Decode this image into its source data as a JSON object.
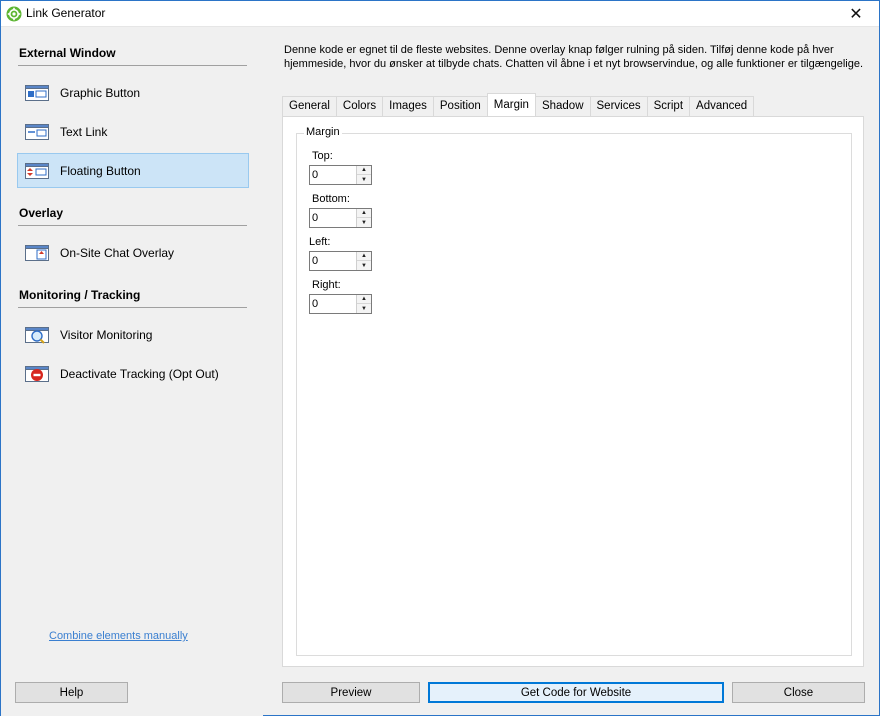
{
  "window": {
    "title": "Link Generator",
    "app_icon": "gear-icon",
    "close_glyph": "✕"
  },
  "sidebar": {
    "sections": [
      {
        "heading": "External Window",
        "items": [
          {
            "label": "Graphic Button",
            "icon": "graphic-button-icon",
            "selected": false
          },
          {
            "label": "Text Link",
            "icon": "text-link-icon",
            "selected": false
          },
          {
            "label": "Floating Button",
            "icon": "floating-button-icon",
            "selected": true
          }
        ]
      },
      {
        "heading": "Overlay",
        "items": [
          {
            "label": "On-Site Chat Overlay",
            "icon": "chat-overlay-icon",
            "selected": false
          }
        ]
      },
      {
        "heading": "Monitoring / Tracking",
        "items": [
          {
            "label": "Visitor Monitoring",
            "icon": "visitor-monitoring-icon",
            "selected": false
          },
          {
            "label": "Deactivate Tracking (Opt Out)",
            "icon": "deactivate-tracking-icon",
            "selected": false
          }
        ]
      }
    ],
    "combine_link": "Combine elements manually"
  },
  "main": {
    "description": "Denne kode er egnet til de fleste websites. Denne overlay knap følger rulning på siden. Tilføj denne kode på hver hjemmeside, hvor du ønsker at tilbyde chats. Chatten vil åbne i et nyt browservindue, og alle funktioner er tilgængelige.",
    "tabs": [
      "General",
      "Colors",
      "Images",
      "Position",
      "Margin",
      "Shadow",
      "Services",
      "Script",
      "Advanced"
    ],
    "active_tab": "Margin",
    "group_label": "Margin",
    "fields": [
      {
        "label": "Top:",
        "value": "0"
      },
      {
        "label": "Bottom:",
        "value": "0"
      },
      {
        "label": "Left:",
        "value": "0"
      },
      {
        "label": "Right:",
        "value": "0"
      }
    ]
  },
  "buttons": {
    "help": "Help",
    "preview": "Preview",
    "get_code": "Get Code for Website",
    "close": "Close"
  },
  "colors": {
    "selection": "#cce4f7",
    "accent": "#0078d7",
    "link": "#3a7fd0"
  }
}
